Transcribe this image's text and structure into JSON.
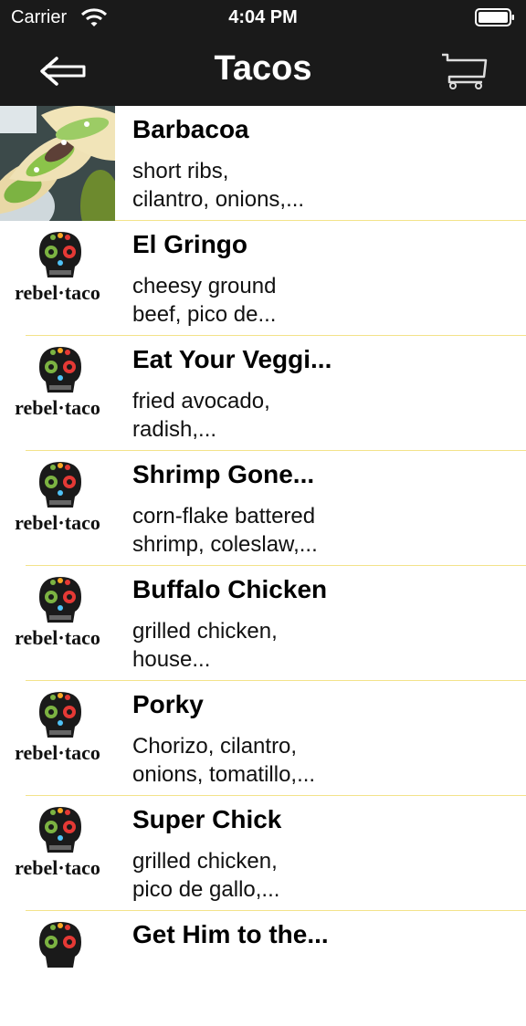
{
  "status_bar": {
    "carrier": "Carrier",
    "time": "4:04 PM"
  },
  "nav": {
    "title": "Tacos",
    "back_icon": "back-arrow-icon",
    "cart_icon": "cart-icon"
  },
  "logo_text": "rebel·taco",
  "items": [
    {
      "name": "Barbacoa",
      "desc_line1": "short ribs,",
      "desc_line2": "cilantro, onions,...",
      "image": "taco-photo"
    },
    {
      "name": "El Gringo",
      "desc_line1": "cheesy ground",
      "desc_line2": "beef, pico de...",
      "image": "rebel-taco-logo"
    },
    {
      "name": "Eat Your Veggi...",
      "desc_line1": "fried avocado,",
      "desc_line2": "radish,...",
      "image": "rebel-taco-logo"
    },
    {
      "name": "Shrimp Gone...",
      "desc_line1": "corn-flake battered",
      "desc_line2": "shrimp, coleslaw,...",
      "image": "rebel-taco-logo"
    },
    {
      "name": "Buffalo Chicken",
      "desc_line1": "grilled chicken,",
      "desc_line2": "house...",
      "image": "rebel-taco-logo"
    },
    {
      "name": "Porky",
      "desc_line1": "Chorizo, cilantro,",
      "desc_line2": "onions, tomatillo,...",
      "image": "rebel-taco-logo"
    },
    {
      "name": "Super Chick",
      "desc_line1": "grilled chicken,",
      "desc_line2": "pico de gallo,...",
      "image": "rebel-taco-logo"
    },
    {
      "name": "Get Him to the...",
      "desc_line1": "",
      "desc_line2": "",
      "image": "rebel-taco-logo"
    }
  ],
  "colors": {
    "bar_bg": "#1a1a1a",
    "separator": "#f3e38a"
  }
}
